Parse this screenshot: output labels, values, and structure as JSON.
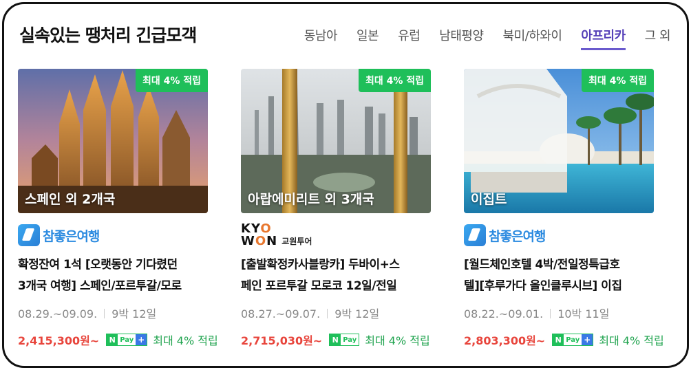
{
  "header": {
    "title": "실속있는 땡처리 긴급모객",
    "tabs": [
      "동남아",
      "일본",
      "유럽",
      "남태평양",
      "북미/하와이",
      "아프리카",
      "그 외"
    ],
    "active_tab": "아프리카"
  },
  "colors": {
    "accent": "#5540b8",
    "badge": "#1fbf5a",
    "price": "#e8453c",
    "reward": "#1fa34e"
  },
  "cards": [
    {
      "badge": "최대 4% 적립",
      "place": "스페인 외 2개국",
      "image": "sagrada-familia-photo",
      "vendor": {
        "type": "chamjoeun",
        "name": "참좋은여행"
      },
      "name_line1": "확정잔여 1석 [오랫동안 기다렸던",
      "name_line2": "3개국 여행] 스페인/포르투갈/모로",
      "dates": "08.29.~09.09.",
      "duration": "9박 12일",
      "price": "2,415,300원~",
      "pay": "Pay",
      "reward": "최대 4% 적립"
    },
    {
      "badge": "최대 4% 적립",
      "place": "아랍에미리트 외 3개국",
      "image": "dubai-frame-photo",
      "vendor": {
        "type": "kyowon",
        "name_top": "KYO",
        "name_bottom": "WON",
        "name_sub": "교원투어"
      },
      "name_line1": "[출발확정카사블랑카] 두바이+스",
      "name_line2": "페인 포르투갈 모로코 12일/전일",
      "dates": "08.27.~09.07.",
      "duration": "9박 12일",
      "price": "2,715,030원~",
      "pay": "Pay",
      "reward": "최대 4% 적립"
    },
    {
      "badge": "최대 4% 적립",
      "place": "이집트",
      "image": "egypt-resort-pool-photo",
      "vendor": {
        "type": "chamjoeun",
        "name": "참좋은여행"
      },
      "name_line1": "[월드체인호텔 4박/전일정특급호",
      "name_line2": "텔][후루가다 올인클루시브] 이집",
      "dates": "08.22.~09.01.",
      "duration": "10박 11일",
      "price": "2,803,300원~",
      "pay": "Pay",
      "reward": "최대 4% 적립"
    }
  ]
}
